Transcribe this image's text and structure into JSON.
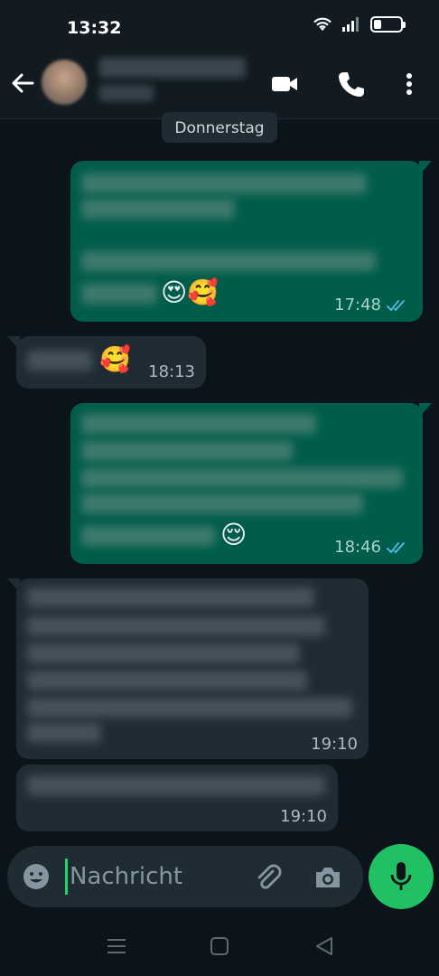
{
  "status_bar": {
    "time": "13:32",
    "icons": [
      "wifi-icon",
      "signal-icon",
      "battery-icon"
    ],
    "battery_level": 0.3
  },
  "header": {
    "contact_name": "",
    "contact_status": "",
    "icons": [
      "back-arrow-icon",
      "video-call-icon",
      "voice-call-icon",
      "more-options-icon"
    ]
  },
  "date_separator": "Donnerstag",
  "messages": [
    {
      "direction": "outgoing",
      "emoji": "😍🥰",
      "time": "17:48",
      "status": "read"
    },
    {
      "direction": "incoming",
      "emoji": "🥰",
      "time": "18:13"
    },
    {
      "direction": "outgoing",
      "emoji": "😌",
      "time": "18:46",
      "status": "read"
    },
    {
      "direction": "incoming",
      "emoji": "",
      "time": "19:10"
    },
    {
      "direction": "incoming",
      "emoji": "",
      "time": "19:10"
    }
  ],
  "composer": {
    "placeholder": "Nachricht",
    "icons": [
      "emoji-icon",
      "attach-icon",
      "camera-icon",
      "mic-icon"
    ]
  },
  "nav_bar": {
    "icons": [
      "recents-icon",
      "home-icon",
      "back-icon"
    ]
  },
  "colors": {
    "background": "#0b141a",
    "outgoing_bubble": "#005c4b",
    "incoming_bubble": "#202c33",
    "accent": "#21c063",
    "read_ticks": "#53bdeb"
  }
}
